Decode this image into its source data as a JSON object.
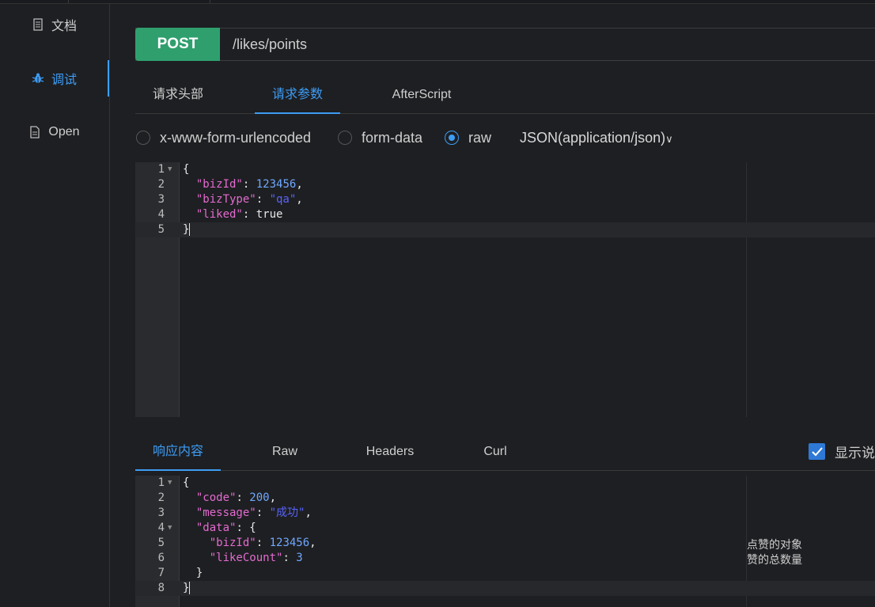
{
  "sidebar": {
    "items": [
      {
        "label": "文档",
        "icon": "document-icon"
      },
      {
        "label": "调试",
        "icon": "bug-icon",
        "active": true
      },
      {
        "label": "Open",
        "icon": "file-icon"
      }
    ]
  },
  "request": {
    "method": "POST",
    "url": "/likes/points",
    "method_color": "#2f9f6e"
  },
  "request_tabs": [
    {
      "label": "请求头部"
    },
    {
      "label": "请求参数",
      "active": true
    },
    {
      "label": "AfterScript"
    }
  ],
  "body_types": [
    {
      "label": "x-www-form-urlencoded",
      "checked": false
    },
    {
      "label": "form-data",
      "checked": false
    },
    {
      "label": "raw",
      "checked": true
    }
  ],
  "content_type": "JSON(application/json)",
  "request_body": {
    "lines": [
      {
        "no": "1",
        "fold": true
      },
      {
        "no": "2"
      },
      {
        "no": "3"
      },
      {
        "no": "4"
      },
      {
        "no": "5",
        "active": true
      }
    ]
  },
  "response_tabs": [
    {
      "label": "响应内容",
      "active": true
    },
    {
      "label": "Raw"
    },
    {
      "label": "Headers"
    },
    {
      "label": "Curl"
    }
  ],
  "show_description": {
    "label": "显示说",
    "checked": true
  },
  "response_body": {
    "lines": [
      {
        "no": "1",
        "fold": true
      },
      {
        "no": "2"
      },
      {
        "no": "3"
      },
      {
        "no": "4",
        "fold": true
      },
      {
        "no": "5"
      },
      {
        "no": "6"
      },
      {
        "no": "7"
      },
      {
        "no": "8",
        "active": true
      }
    ]
  },
  "annotations": {
    "bizId": "点赞的对象",
    "likeCount": "赞的总数量"
  },
  "colors": {
    "accent": "#3d9cf5",
    "key": "#e36bd0",
    "number": "#6fa8ff",
    "string": "#5863f8"
  }
}
